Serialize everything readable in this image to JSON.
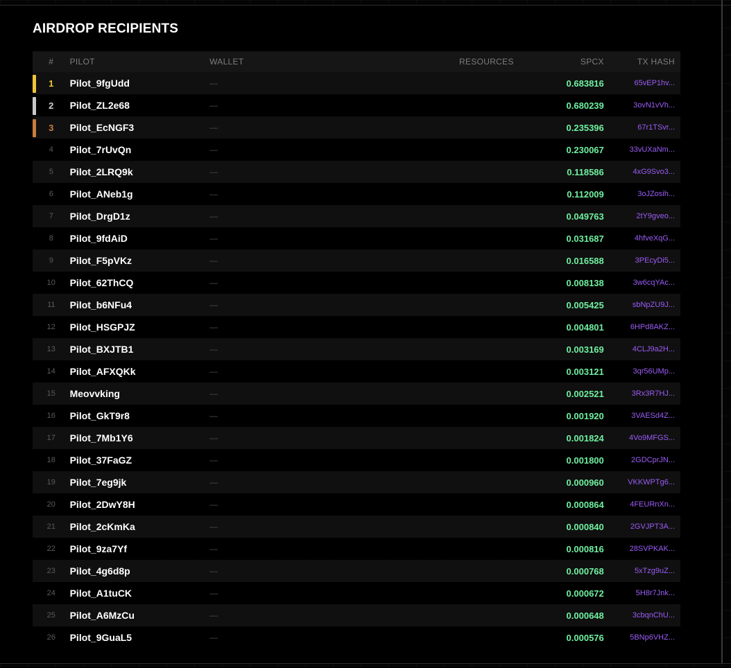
{
  "title": "AIRDROP RECIPIENTS",
  "columns": {
    "rank": "#",
    "pilot": "PILOT",
    "wallet": "WALLET",
    "resources": "RESOURCES",
    "spcx": "SPCX",
    "tx_hash": "TX HASH"
  },
  "podium_colors": [
    "#f0c43c",
    "#c9c9c9",
    "#c87d3c"
  ],
  "rows": [
    {
      "rank": "1",
      "pilot": "Pilot_9fgUdd",
      "wallet": "—",
      "resources": "",
      "spcx": "0.683816",
      "tx": "65vEP1hv..."
    },
    {
      "rank": "2",
      "pilot": "Pilot_ZL2e68",
      "wallet": "—",
      "resources": "",
      "spcx": "0.680239",
      "tx": "3ovN1vVh..."
    },
    {
      "rank": "3",
      "pilot": "Pilot_EcNGF3",
      "wallet": "—",
      "resources": "",
      "spcx": "0.235396",
      "tx": "67r1TSvr..."
    },
    {
      "rank": "4",
      "pilot": "Pilot_7rUvQn",
      "wallet": "—",
      "resources": "",
      "spcx": "0.230067",
      "tx": "33vUXaNm..."
    },
    {
      "rank": "5",
      "pilot": "Pilot_2LRQ9k",
      "wallet": "—",
      "resources": "",
      "spcx": "0.118586",
      "tx": "4xG9Svo3..."
    },
    {
      "rank": "6",
      "pilot": "Pilot_ANeb1g",
      "wallet": "—",
      "resources": "",
      "spcx": "0.112009",
      "tx": "3oJZosih..."
    },
    {
      "rank": "7",
      "pilot": "Pilot_DrgD1z",
      "wallet": "—",
      "resources": "",
      "spcx": "0.049763",
      "tx": "2tY9gveo..."
    },
    {
      "rank": "8",
      "pilot": "Pilot_9fdAiD",
      "wallet": "—",
      "resources": "",
      "spcx": "0.031687",
      "tx": "4hfveXqG..."
    },
    {
      "rank": "9",
      "pilot": "Pilot_F5pVKz",
      "wallet": "—",
      "resources": "",
      "spcx": "0.016588",
      "tx": "3PEcyDi5..."
    },
    {
      "rank": "10",
      "pilot": "Pilot_62ThCQ",
      "wallet": "—",
      "resources": "",
      "spcx": "0.008138",
      "tx": "3w6cqYAc..."
    },
    {
      "rank": "11",
      "pilot": "Pilot_b6NFu4",
      "wallet": "—",
      "resources": "",
      "spcx": "0.005425",
      "tx": "sbNpZU9J..."
    },
    {
      "rank": "12",
      "pilot": "Pilot_HSGPJZ",
      "wallet": "—",
      "resources": "",
      "spcx": "0.004801",
      "tx": "6HPd8AKZ..."
    },
    {
      "rank": "13",
      "pilot": "Pilot_BXJTB1",
      "wallet": "—",
      "resources": "",
      "spcx": "0.003169",
      "tx": "4CLJ9a2H..."
    },
    {
      "rank": "14",
      "pilot": "Pilot_AFXQKk",
      "wallet": "—",
      "resources": "",
      "spcx": "0.003121",
      "tx": "3qr56UMp..."
    },
    {
      "rank": "15",
      "pilot": "Meovvking",
      "wallet": "—",
      "resources": "",
      "spcx": "0.002521",
      "tx": "3Rx3R7HJ..."
    },
    {
      "rank": "16",
      "pilot": "Pilot_GkT9r8",
      "wallet": "—",
      "resources": "",
      "spcx": "0.001920",
      "tx": "3VAESd4Z..."
    },
    {
      "rank": "17",
      "pilot": "Pilot_7Mb1Y6",
      "wallet": "—",
      "resources": "",
      "spcx": "0.001824",
      "tx": "4Vo9MFGS..."
    },
    {
      "rank": "18",
      "pilot": "Pilot_37FaGZ",
      "wallet": "—",
      "resources": "",
      "spcx": "0.001800",
      "tx": "2GDCprJN..."
    },
    {
      "rank": "19",
      "pilot": "Pilot_7eg9jk",
      "wallet": "—",
      "resources": "",
      "spcx": "0.000960",
      "tx": "VKKWPTg6..."
    },
    {
      "rank": "20",
      "pilot": "Pilot_2DwY8H",
      "wallet": "—",
      "resources": "",
      "spcx": "0.000864",
      "tx": "4FEURnXn..."
    },
    {
      "rank": "21",
      "pilot": "Pilot_2cKmKa",
      "wallet": "—",
      "resources": "",
      "spcx": "0.000840",
      "tx": "2GVJPT3A..."
    },
    {
      "rank": "22",
      "pilot": "Pilot_9za7Yf",
      "wallet": "—",
      "resources": "",
      "spcx": "0.000816",
      "tx": "28SVPKAK..."
    },
    {
      "rank": "23",
      "pilot": "Pilot_4g6d8p",
      "wallet": "—",
      "resources": "",
      "spcx": "0.000768",
      "tx": "5xTzg9uZ..."
    },
    {
      "rank": "24",
      "pilot": "Pilot_A1tuCK",
      "wallet": "—",
      "resources": "",
      "spcx": "0.000672",
      "tx": "5H8r7Jnk..."
    },
    {
      "rank": "25",
      "pilot": "Pilot_A6MzCu",
      "wallet": "—",
      "resources": "",
      "spcx": "0.000648",
      "tx": "3cbqnChU..."
    },
    {
      "rank": "26",
      "pilot": "Pilot_9GuaL5",
      "wallet": "—",
      "resources": "",
      "spcx": "0.000576",
      "tx": "5BNp6VHZ..."
    }
  ]
}
